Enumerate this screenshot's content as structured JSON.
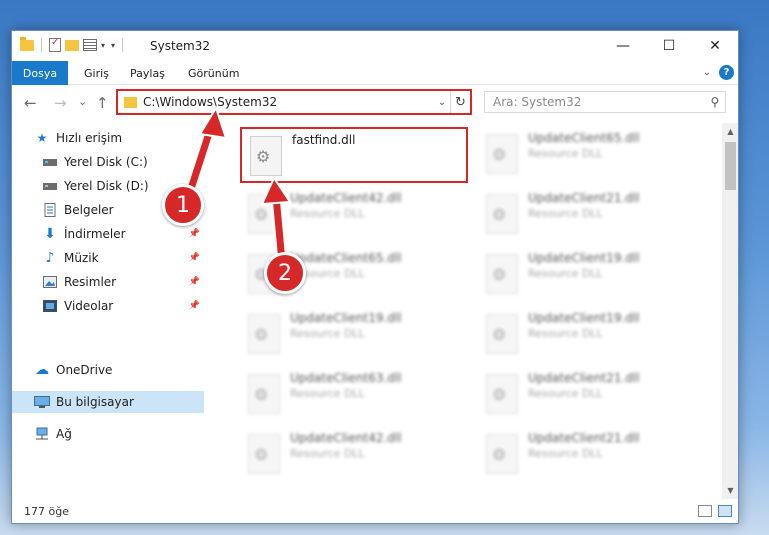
{
  "window": {
    "title": "System32",
    "controls": {
      "minimize": "—",
      "maximize": "☐",
      "close": "✕"
    }
  },
  "ribbon": {
    "tabs": [
      "Dosya",
      "Giriş",
      "Paylaş",
      "Görünüm"
    ],
    "help": "?"
  },
  "nav": {
    "back": "←",
    "forward": "→",
    "recent": "⌄",
    "up": "↑",
    "address": "C:\\Windows\\System32",
    "search_placeholder": "Ara: System32"
  },
  "sidebar": {
    "items": [
      {
        "label": "Hızlı erişim",
        "icon": "star-icon",
        "pinned": false
      },
      {
        "label": "Yerel Disk (C:)",
        "icon": "drive-icon",
        "pinned": false
      },
      {
        "label": "Yerel Disk (D:)",
        "icon": "drive-icon",
        "pinned": false
      },
      {
        "label": "Belgeler",
        "icon": "document-icon",
        "pinned": false
      },
      {
        "label": "İndirmeler",
        "icon": "download-icon",
        "pinned": true
      },
      {
        "label": "Müzik",
        "icon": "music-icon",
        "pinned": true
      },
      {
        "label": "Resimler",
        "icon": "pictures-icon",
        "pinned": true
      },
      {
        "label": "Videolar",
        "icon": "video-icon",
        "pinned": true
      },
      {
        "label": "OneDrive",
        "icon": "cloud-icon",
        "pinned": false
      },
      {
        "label": "Bu bilgisayar",
        "icon": "computer-icon",
        "pinned": false,
        "selected": true
      },
      {
        "label": "Ağ",
        "icon": "network-icon",
        "pinned": false
      }
    ]
  },
  "files": {
    "left": [
      {
        "name": "fastfind.dll",
        "type": ""
      },
      {
        "name": "UpdateClient42.dll",
        "type": "Resource DLL"
      },
      {
        "name": "UpdateClient65.dll",
        "type": "Resource DLL"
      },
      {
        "name": "UpdateClient19.dll",
        "type": "Resource DLL"
      },
      {
        "name": "UpdateClient63.dll",
        "type": "Resource DLL"
      },
      {
        "name": "UpdateClient42.dll",
        "type": "Resource DLL"
      }
    ],
    "right": [
      {
        "name": "UpdateClient65.dll",
        "type": "Resource DLL"
      },
      {
        "name": "UpdateClient21.dll",
        "type": "Resource DLL"
      },
      {
        "name": "UpdateClient19.dll",
        "type": "Resource DLL"
      },
      {
        "name": "UpdateClient19.dll",
        "type": "Resource DLL"
      },
      {
        "name": "UpdateClient21.dll",
        "type": "Resource DLL"
      },
      {
        "name": "UpdateClient21.dll",
        "type": "Resource DLL"
      }
    ]
  },
  "status": {
    "count": "177 öğe"
  },
  "annotations": {
    "step1": "1",
    "step2": "2",
    "color": "#d62828"
  }
}
